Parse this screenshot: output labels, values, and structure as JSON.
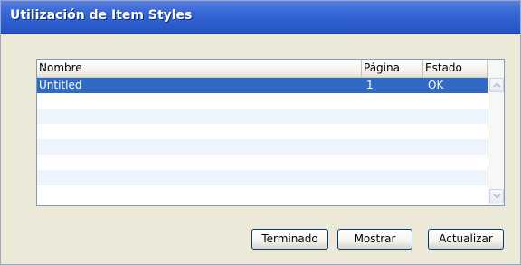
{
  "window": {
    "title": "Utilización de Item Styles"
  },
  "listview": {
    "columns": [
      "Nombre",
      "Página",
      "Estado"
    ],
    "rows": [
      {
        "nombre": "Untitled",
        "pagina": "1",
        "estado": "OK",
        "selected": true
      }
    ]
  },
  "buttons": {
    "terminado": "Terminado",
    "mostrar": "Mostrar",
    "actualizar": "Actualizar"
  },
  "colors": {
    "selection": "#316ac5",
    "titlebar": "#2c5ccc",
    "dialog_bg": "#ece9d8"
  }
}
